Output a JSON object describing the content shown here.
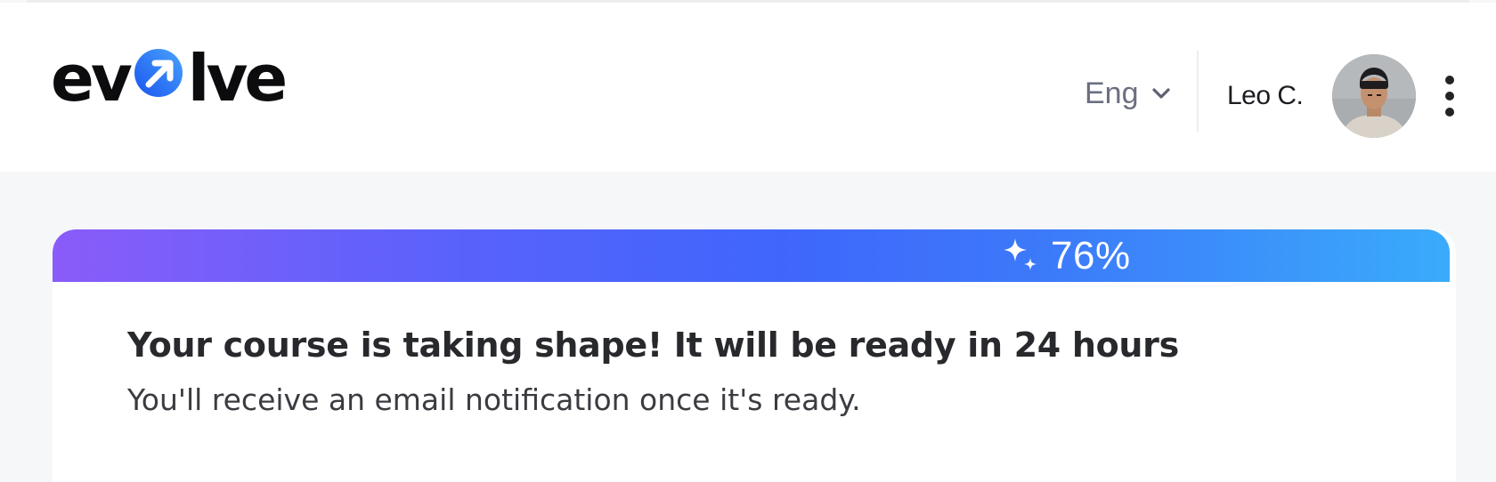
{
  "header": {
    "logo": {
      "text_before": "ev",
      "text_after": "lve",
      "full_text": "evolve",
      "accent_color": "#2f6bf5"
    },
    "language": {
      "selected": "Eng",
      "icon": "chevron-down-icon"
    },
    "user": {
      "name": "Leo C.",
      "avatar_icon": "avatar"
    },
    "menu_icon": "more-vertical-icon"
  },
  "progress": {
    "value": 76,
    "label": "76%",
    "icon": "sparkles-icon",
    "gradient": [
      "#8a5cf9",
      "#3f66fb",
      "#3aabfb"
    ]
  },
  "message": {
    "title": "Your course is taking shape! It will be ready in 24 hours",
    "subtitle": "You'll receive an email notification once it's ready."
  }
}
